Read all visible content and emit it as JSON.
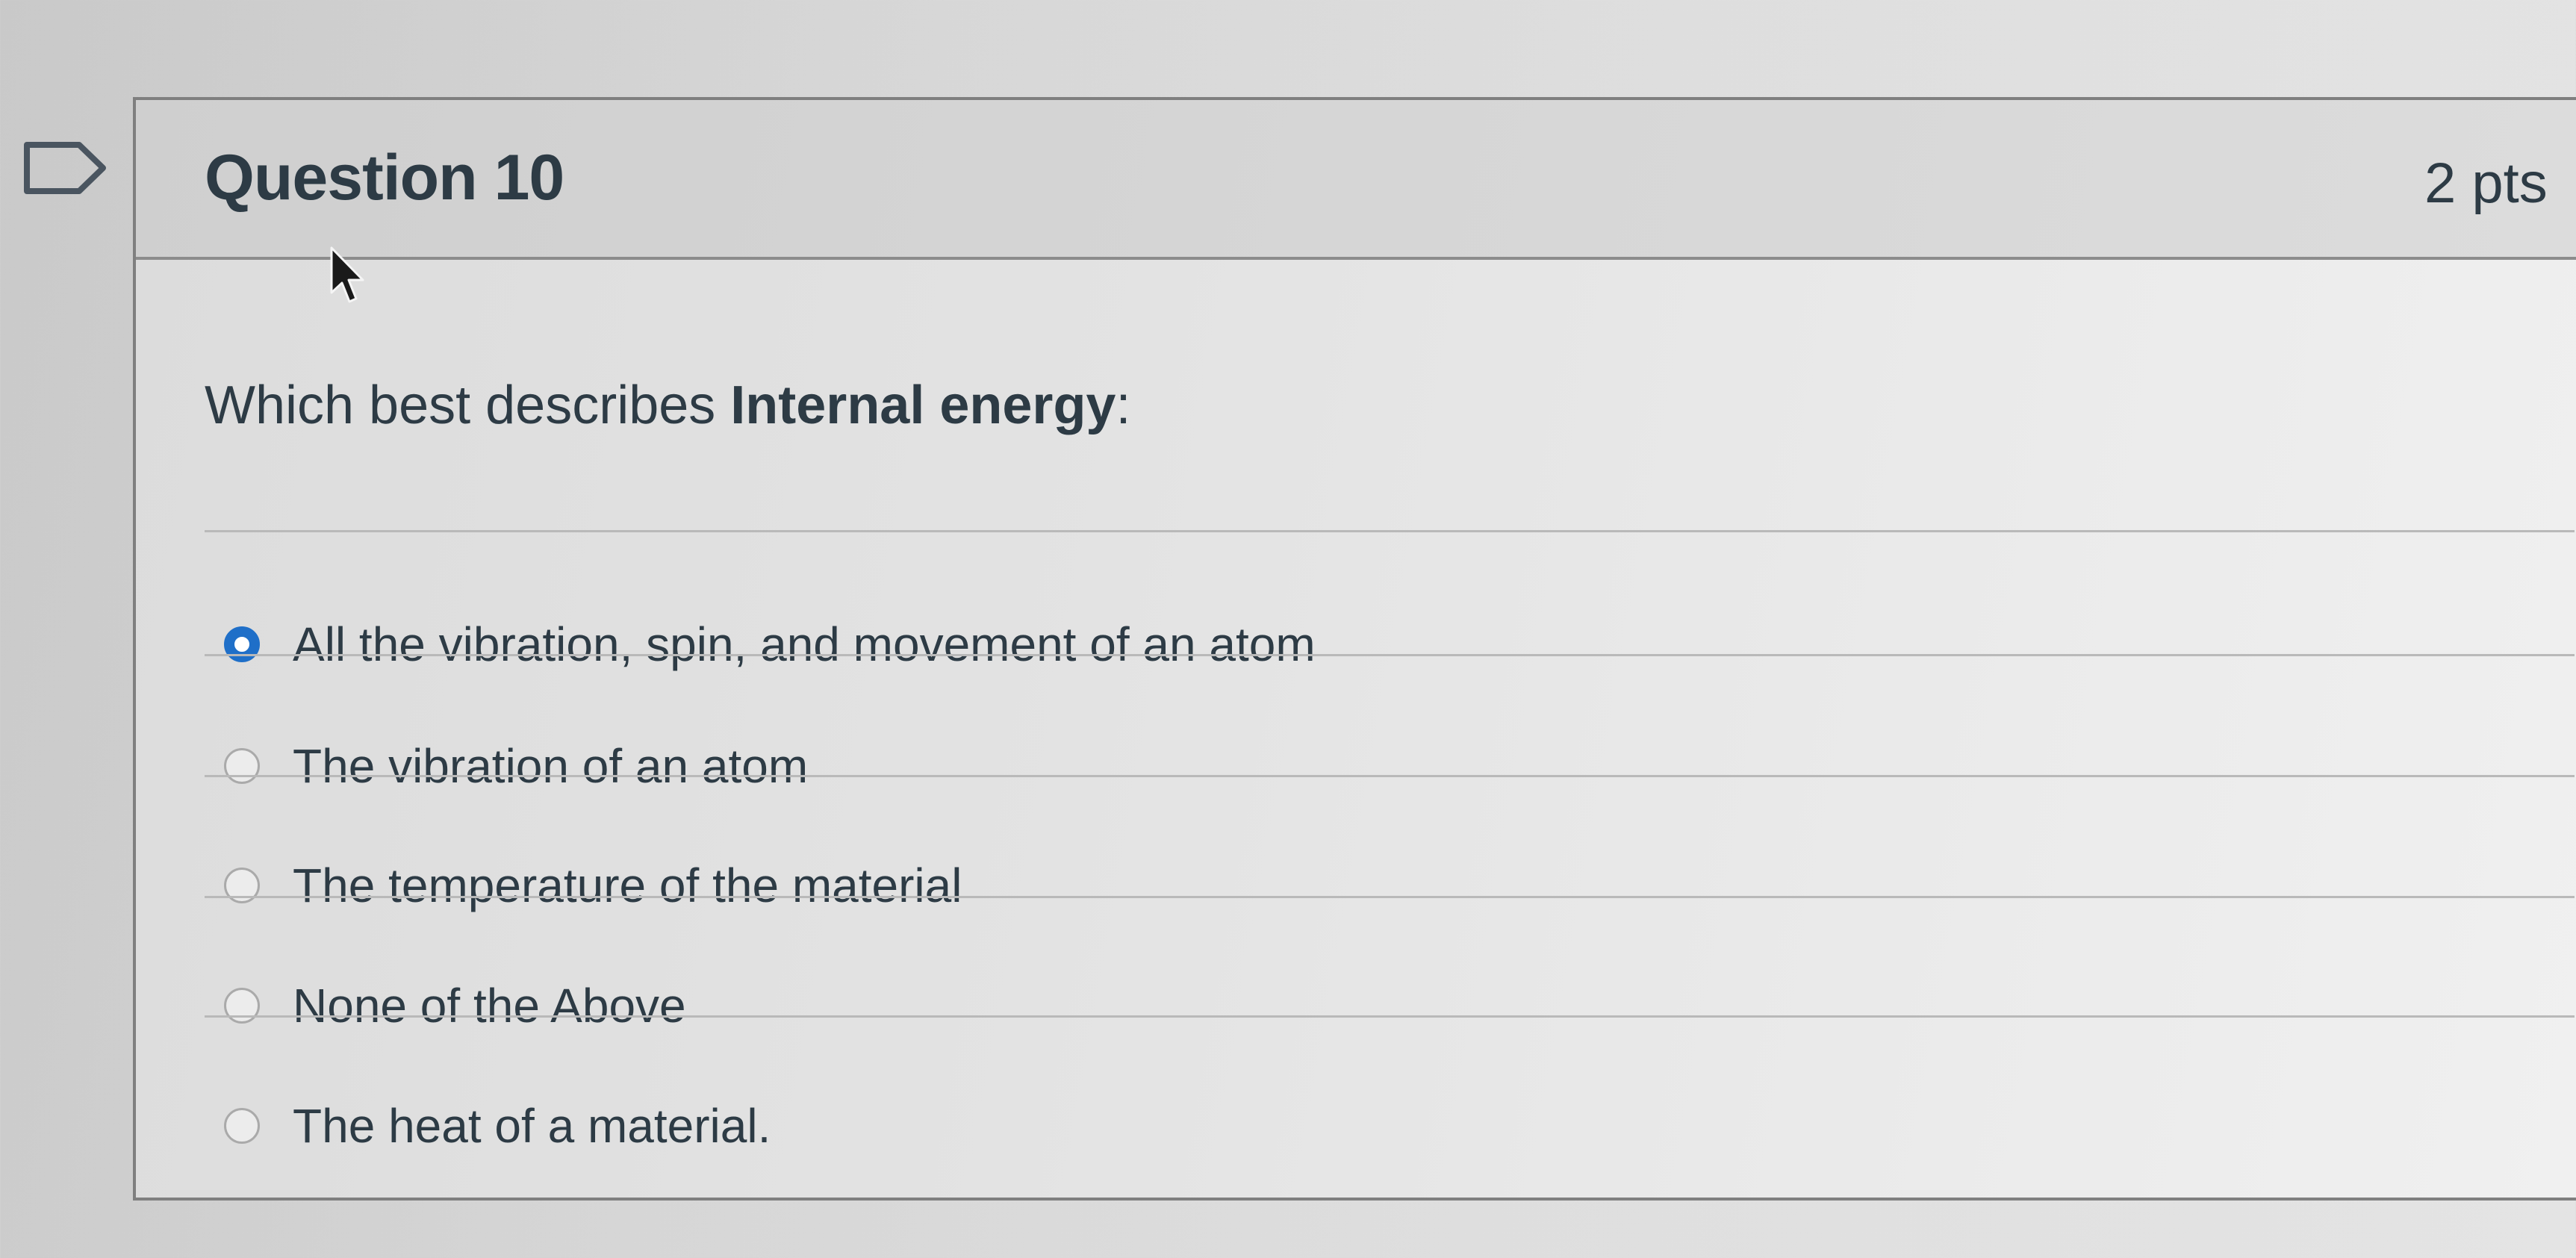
{
  "question": {
    "title": "Question 10",
    "points": "2 pts",
    "prompt_prefix": "Which best describes ",
    "prompt_bold": "Internal energy",
    "prompt_suffix": ":"
  },
  "answers": [
    {
      "label": "All the vibration, spin, and movement of an atom",
      "selected": true
    },
    {
      "label": "The vibration of an atom",
      "selected": false
    },
    {
      "label": "The temperature of the material",
      "selected": false
    },
    {
      "label": "None of the Above",
      "selected": false
    },
    {
      "label": "The heat of a material.",
      "selected": false
    }
  ],
  "colors": {
    "selected_radio": "#1f6fc8",
    "text": "#2d3b45"
  },
  "icons": {
    "flag": "flag-icon",
    "cursor": "mouse-pointer-icon"
  }
}
